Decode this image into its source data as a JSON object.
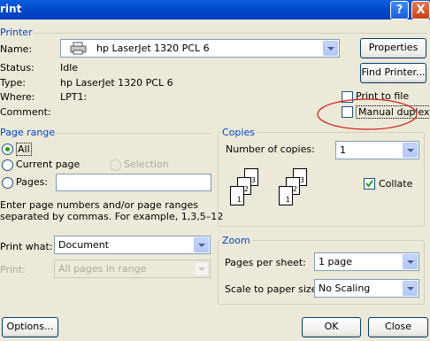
{
  "window": {
    "title": "rint",
    "help_glyph": "?",
    "close_glyph": "X"
  },
  "printer": {
    "section_label": "Printer",
    "name_label": "Name:",
    "name_value": "hp LaserJet 1320 PCL 6",
    "properties_label": "Properties",
    "status_label": "Status:",
    "status_value": "Idle",
    "type_label": "Type:",
    "type_value": "hp LaserJet 1320 PCL 6",
    "where_label": "Where:",
    "where_value": "LPT1:",
    "comment_label": "Comment:",
    "find_printer_label": "Find Printer...",
    "print_to_file_label": "Print to file",
    "manual_duplex_label": "Manual duplex",
    "print_to_file_checked": false,
    "manual_duplex_checked": false
  },
  "page_range": {
    "section_label": "Page range",
    "all_label": "All",
    "current_page_label": "Current page",
    "selection_label": "Selection",
    "pages_label": "Pages:",
    "pages_value": "",
    "help_text_1": "Enter page numbers and/or page ranges",
    "help_text_2": "separated by commas.  For example, 1,3,5–12",
    "selected": "All"
  },
  "copies": {
    "section_label": "Copies",
    "number_label": "Number of copies:",
    "number_value": "1",
    "collate_label": "Collate",
    "collate_checked": true,
    "stack_pages": [
      "3",
      "2",
      "1"
    ]
  },
  "print_what": {
    "label": "Print what:",
    "value": "Document",
    "print_label": "Print:",
    "print_value": "All pages in range"
  },
  "zoom": {
    "section_label": "Zoom",
    "pages_per_sheet_label": "Pages per sheet:",
    "pages_per_sheet_value": "1 page",
    "scale_label": "Scale to paper size:",
    "scale_value": "No Scaling"
  },
  "buttons": {
    "options": "Options...",
    "ok": "OK",
    "cancel": "Close"
  },
  "colors": {
    "section_blue": "#0046D5",
    "dialog_bg": "#ECE9D8",
    "title_blue": "#0A5EE0",
    "annotation_red": "#D02020"
  }
}
